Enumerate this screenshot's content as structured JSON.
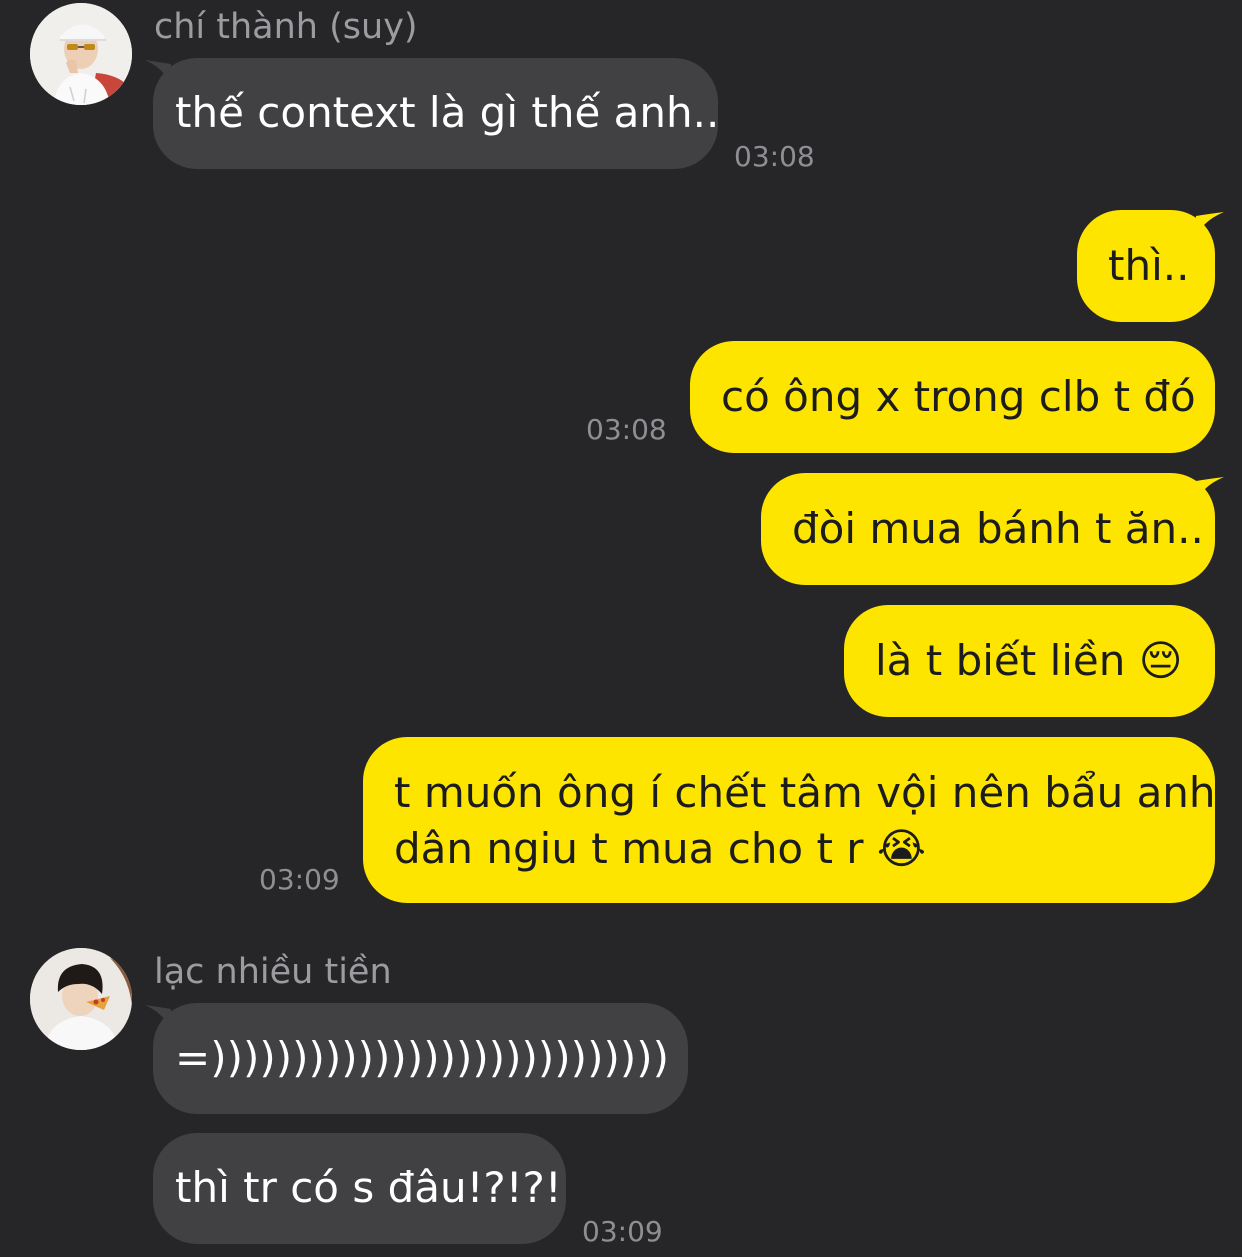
{
  "conversation": {
    "messages": {
      "m1": {
        "sender": "chí thành (suy)",
        "text": "thế context là gì thế anh..",
        "time": "03:08"
      },
      "m2": {
        "text": "thì.."
      },
      "m3": {
        "text": "có ông x trong clb t đó",
        "time": "03:08"
      },
      "m4": {
        "text": "đòi mua bánh t ăn.."
      },
      "m5": {
        "text": "là t biết liền 😔"
      },
      "m6": {
        "line1": "t muốn ông í chết tâm vội nên bẩu anh",
        "line2": "dân ngiu t mua cho t r 😭",
        "time": "03:09"
      },
      "m7": {
        "sender": "lạc nhiều tiền",
        "text": "=))))))))))))))))))))))))))))"
      },
      "m8": {
        "text": "thì tr có s đâu!?!?!",
        "time": "03:09"
      }
    }
  },
  "colors": {
    "background": "#262628",
    "incoming_bubble": "#414143",
    "outgoing_bubble": "#fee500",
    "sender_name": "#9c9ca0",
    "timestamp": "#8e8e93"
  },
  "icons": {
    "avatar1": "profile-photo-person-white-cap-sunglasses",
    "avatar2": "profile-photo-person-eating-pizza"
  }
}
